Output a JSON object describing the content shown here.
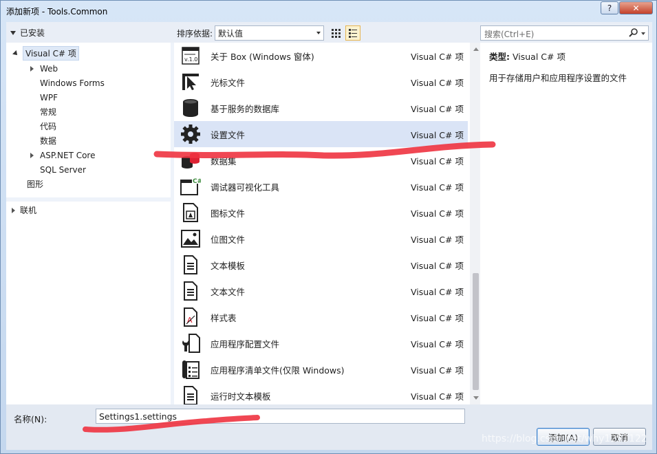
{
  "window": {
    "title": "添加新项 - Tools.Common",
    "help_label": "?",
    "close_label": "✕"
  },
  "toolbar": {
    "installed_label": "已安装",
    "sort_label": "排序依据:",
    "sort_value": "默认值",
    "search_placeholder": "搜索(Ctrl+E)"
  },
  "tree": {
    "root": "Visual C# 项",
    "children": [
      {
        "label": "Web",
        "expandable": true
      },
      {
        "label": "Windows Forms",
        "expandable": false
      },
      {
        "label": "WPF",
        "expandable": false
      },
      {
        "label": "常规",
        "expandable": false
      },
      {
        "label": "代码",
        "expandable": false
      },
      {
        "label": "数据",
        "expandable": false
      },
      {
        "label": "ASP.NET Core",
        "expandable": true
      },
      {
        "label": "SQL Server",
        "expandable": false
      }
    ],
    "graphics": "图形",
    "online": "联机"
  },
  "items": [
    {
      "name": "关于 Box (Windows 窗体)",
      "type": "Visual C# 项",
      "icon": "about-box-icon"
    },
    {
      "name": "光标文件",
      "type": "Visual C# 项",
      "icon": "cursor-file-icon"
    },
    {
      "name": "基于服务的数据库",
      "type": "Visual C# 项",
      "icon": "database-icon"
    },
    {
      "name": "设置文件",
      "type": "Visual C# 项",
      "icon": "settings-gear-icon"
    },
    {
      "name": "数据集",
      "type": "Visual C# 项",
      "icon": "dataset-icon"
    },
    {
      "name": "调试器可视化工具",
      "type": "Visual C# 项",
      "icon": "debugger-visualizer-icon"
    },
    {
      "name": "图标文件",
      "type": "Visual C# 项",
      "icon": "icon-file-icon"
    },
    {
      "name": "位图文件",
      "type": "Visual C# 项",
      "icon": "bitmap-file-icon"
    },
    {
      "name": "文本模板",
      "type": "Visual C# 项",
      "icon": "text-template-icon"
    },
    {
      "name": "文本文件",
      "type": "Visual C# 项",
      "icon": "text-file-icon"
    },
    {
      "name": "样式表",
      "type": "Visual C# 项",
      "icon": "stylesheet-icon"
    },
    {
      "name": "应用程序配置文件",
      "type": "Visual C# 项",
      "icon": "app-config-icon"
    },
    {
      "name": "应用程序清单文件(仅限 Windows)",
      "type": "Visual C# 项",
      "icon": "app-manifest-icon"
    },
    {
      "name": "运行时文本模板",
      "type": "Visual C# 项",
      "icon": "runtime-template-icon"
    }
  ],
  "detail": {
    "type_label": "类型:",
    "type_value": "Visual C# 项",
    "description": "用于存储用户和应用程序设置的文件"
  },
  "footer": {
    "name_label": "名称(N):",
    "name_value": "Settings1.settings",
    "add_label": "添加(A)",
    "cancel_label": "取消"
  },
  "watermark": "https://blog.csdn.net/why1251122",
  "colors": {
    "accent": "#3d7fc7",
    "selection": "#dae4f6",
    "annotation": "#ee3340"
  }
}
